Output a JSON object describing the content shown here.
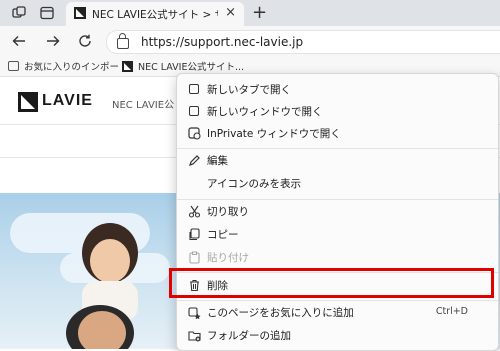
{
  "browser": {
    "tab_title": "NEC LAVIE公式サイト > サービス＆サ",
    "tab_close": "×",
    "new_tab": "+",
    "url": "https://support.nec-lavie.jp"
  },
  "bookmarks": [
    {
      "label": "お気に入りのインポート",
      "icon": "folder-import-icon"
    },
    {
      "label": "NEC LAVIE公式サイト...",
      "icon": "nec-favicon"
    }
  ],
  "site": {
    "logo_text": "LAVIE",
    "subtitle": "NEC LAVIE公"
  },
  "context_menu": {
    "items": [
      {
        "label": "新しいタブで開く",
        "icon": "new-tab-icon",
        "shortcut": "",
        "disabled": false
      },
      {
        "label": "新しいウィンドウで開く",
        "icon": "new-window-icon",
        "shortcut": "",
        "disabled": false
      },
      {
        "label": "InPrivate ウィンドウで開く",
        "icon": "inprivate-icon",
        "shortcut": "",
        "disabled": false
      },
      {
        "label": "編集",
        "icon": "edit-icon",
        "shortcut": "",
        "disabled": false
      },
      {
        "label": "アイコンのみを表示",
        "icon": "",
        "shortcut": "",
        "disabled": false
      },
      {
        "label": "切り取り",
        "icon": "cut-icon",
        "shortcut": "",
        "disabled": false
      },
      {
        "label": "コピー",
        "icon": "copy-icon",
        "shortcut": "",
        "disabled": false
      },
      {
        "label": "貼り付け",
        "icon": "paste-icon",
        "shortcut": "",
        "disabled": true
      },
      {
        "label": "削除",
        "icon": "delete-icon",
        "shortcut": "",
        "disabled": false
      },
      {
        "label": "このページをお気に入りに追加",
        "icon": "add-favorite-icon",
        "shortcut": "Ctrl+D",
        "disabled": false
      },
      {
        "label": "フォルダーの追加",
        "icon": "add-folder-icon",
        "shortcut": "",
        "disabled": false
      }
    ]
  },
  "colors": {
    "highlight": "#e00000",
    "tabbar": "#dfe3e8"
  }
}
